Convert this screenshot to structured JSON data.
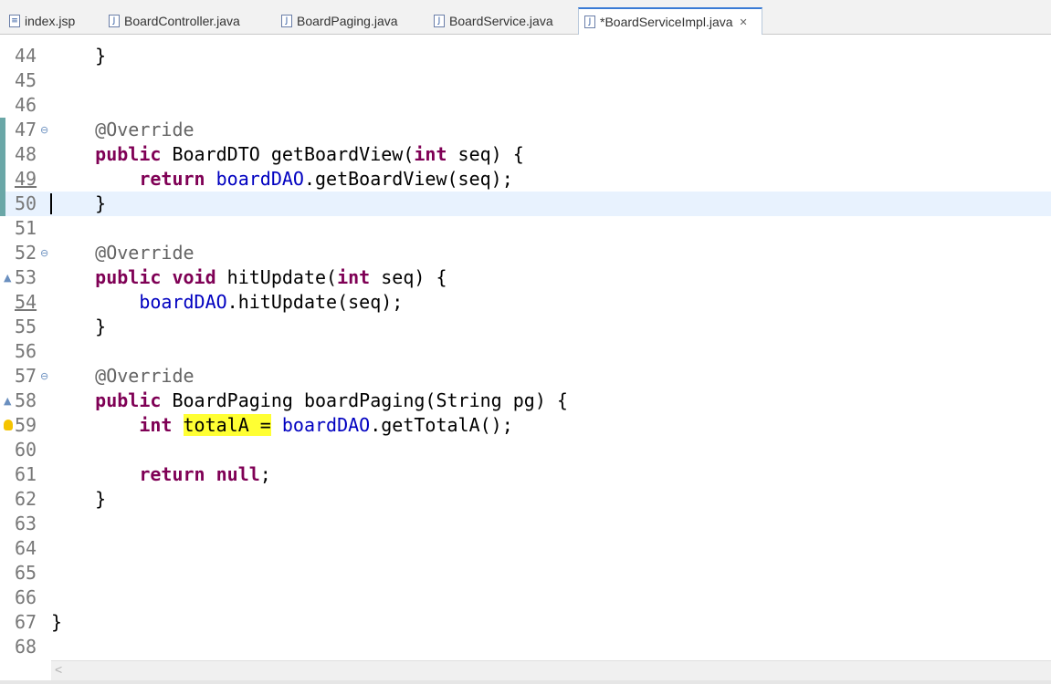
{
  "tabs": [
    {
      "label": "index.jsp",
      "icon": "jsp-file-icon"
    },
    {
      "label": "BoardController.java",
      "icon": "java-file-icon"
    },
    {
      "label": "BoardPaging.java",
      "icon": "java-file-icon"
    },
    {
      "label": "BoardService.java",
      "icon": "java-file-icon"
    },
    {
      "label": "*BoardServiceImpl.java",
      "icon": "java-file-icon",
      "active": true,
      "close": "✕"
    }
  ],
  "editor": {
    "lines": [
      {
        "n": "44",
        "code": "    }"
      },
      {
        "n": "45",
        "code": ""
      },
      {
        "n": "46",
        "code": ""
      },
      {
        "n": "47",
        "code": "    @Override"
      },
      {
        "n": "48",
        "code": "    public BoardDTO getBoardView(int seq) {"
      },
      {
        "n": "49",
        "code": "        return boardDAO.getBoardView(seq);"
      },
      {
        "n": "50",
        "code": "    }"
      },
      {
        "n": "51",
        "code": ""
      },
      {
        "n": "52",
        "code": "    @Override"
      },
      {
        "n": "53",
        "code": "    public void hitUpdate(int seq) {"
      },
      {
        "n": "54",
        "code": "        boardDAO.hitUpdate(seq);"
      },
      {
        "n": "55",
        "code": "    }"
      },
      {
        "n": "56",
        "code": ""
      },
      {
        "n": "57",
        "code": "    @Override"
      },
      {
        "n": "58",
        "code": "    public BoardPaging boardPaging(String pg) {"
      },
      {
        "n": "59",
        "code": "        int totalA = boardDAO.getTotalA();"
      },
      {
        "n": "60",
        "code": ""
      },
      {
        "n": "61",
        "code": "        return null;"
      },
      {
        "n": "62",
        "code": "    }"
      },
      {
        "n": "63",
        "code": ""
      },
      {
        "n": "64",
        "code": ""
      },
      {
        "n": "65",
        "code": ""
      },
      {
        "n": "66",
        "code": ""
      },
      {
        "n": "67",
        "code": "}"
      },
      {
        "n": "68",
        "code": ""
      }
    ],
    "current_line": "50",
    "highlight_word": "totalA =",
    "colors": {
      "keyword": "#7f0055",
      "field": "#0000c0",
      "annotation": "#646464",
      "highlight": "#ffff33",
      "current_line": "#e8f2fe"
    }
  },
  "scrollbar": {
    "left_arrow": "<"
  }
}
